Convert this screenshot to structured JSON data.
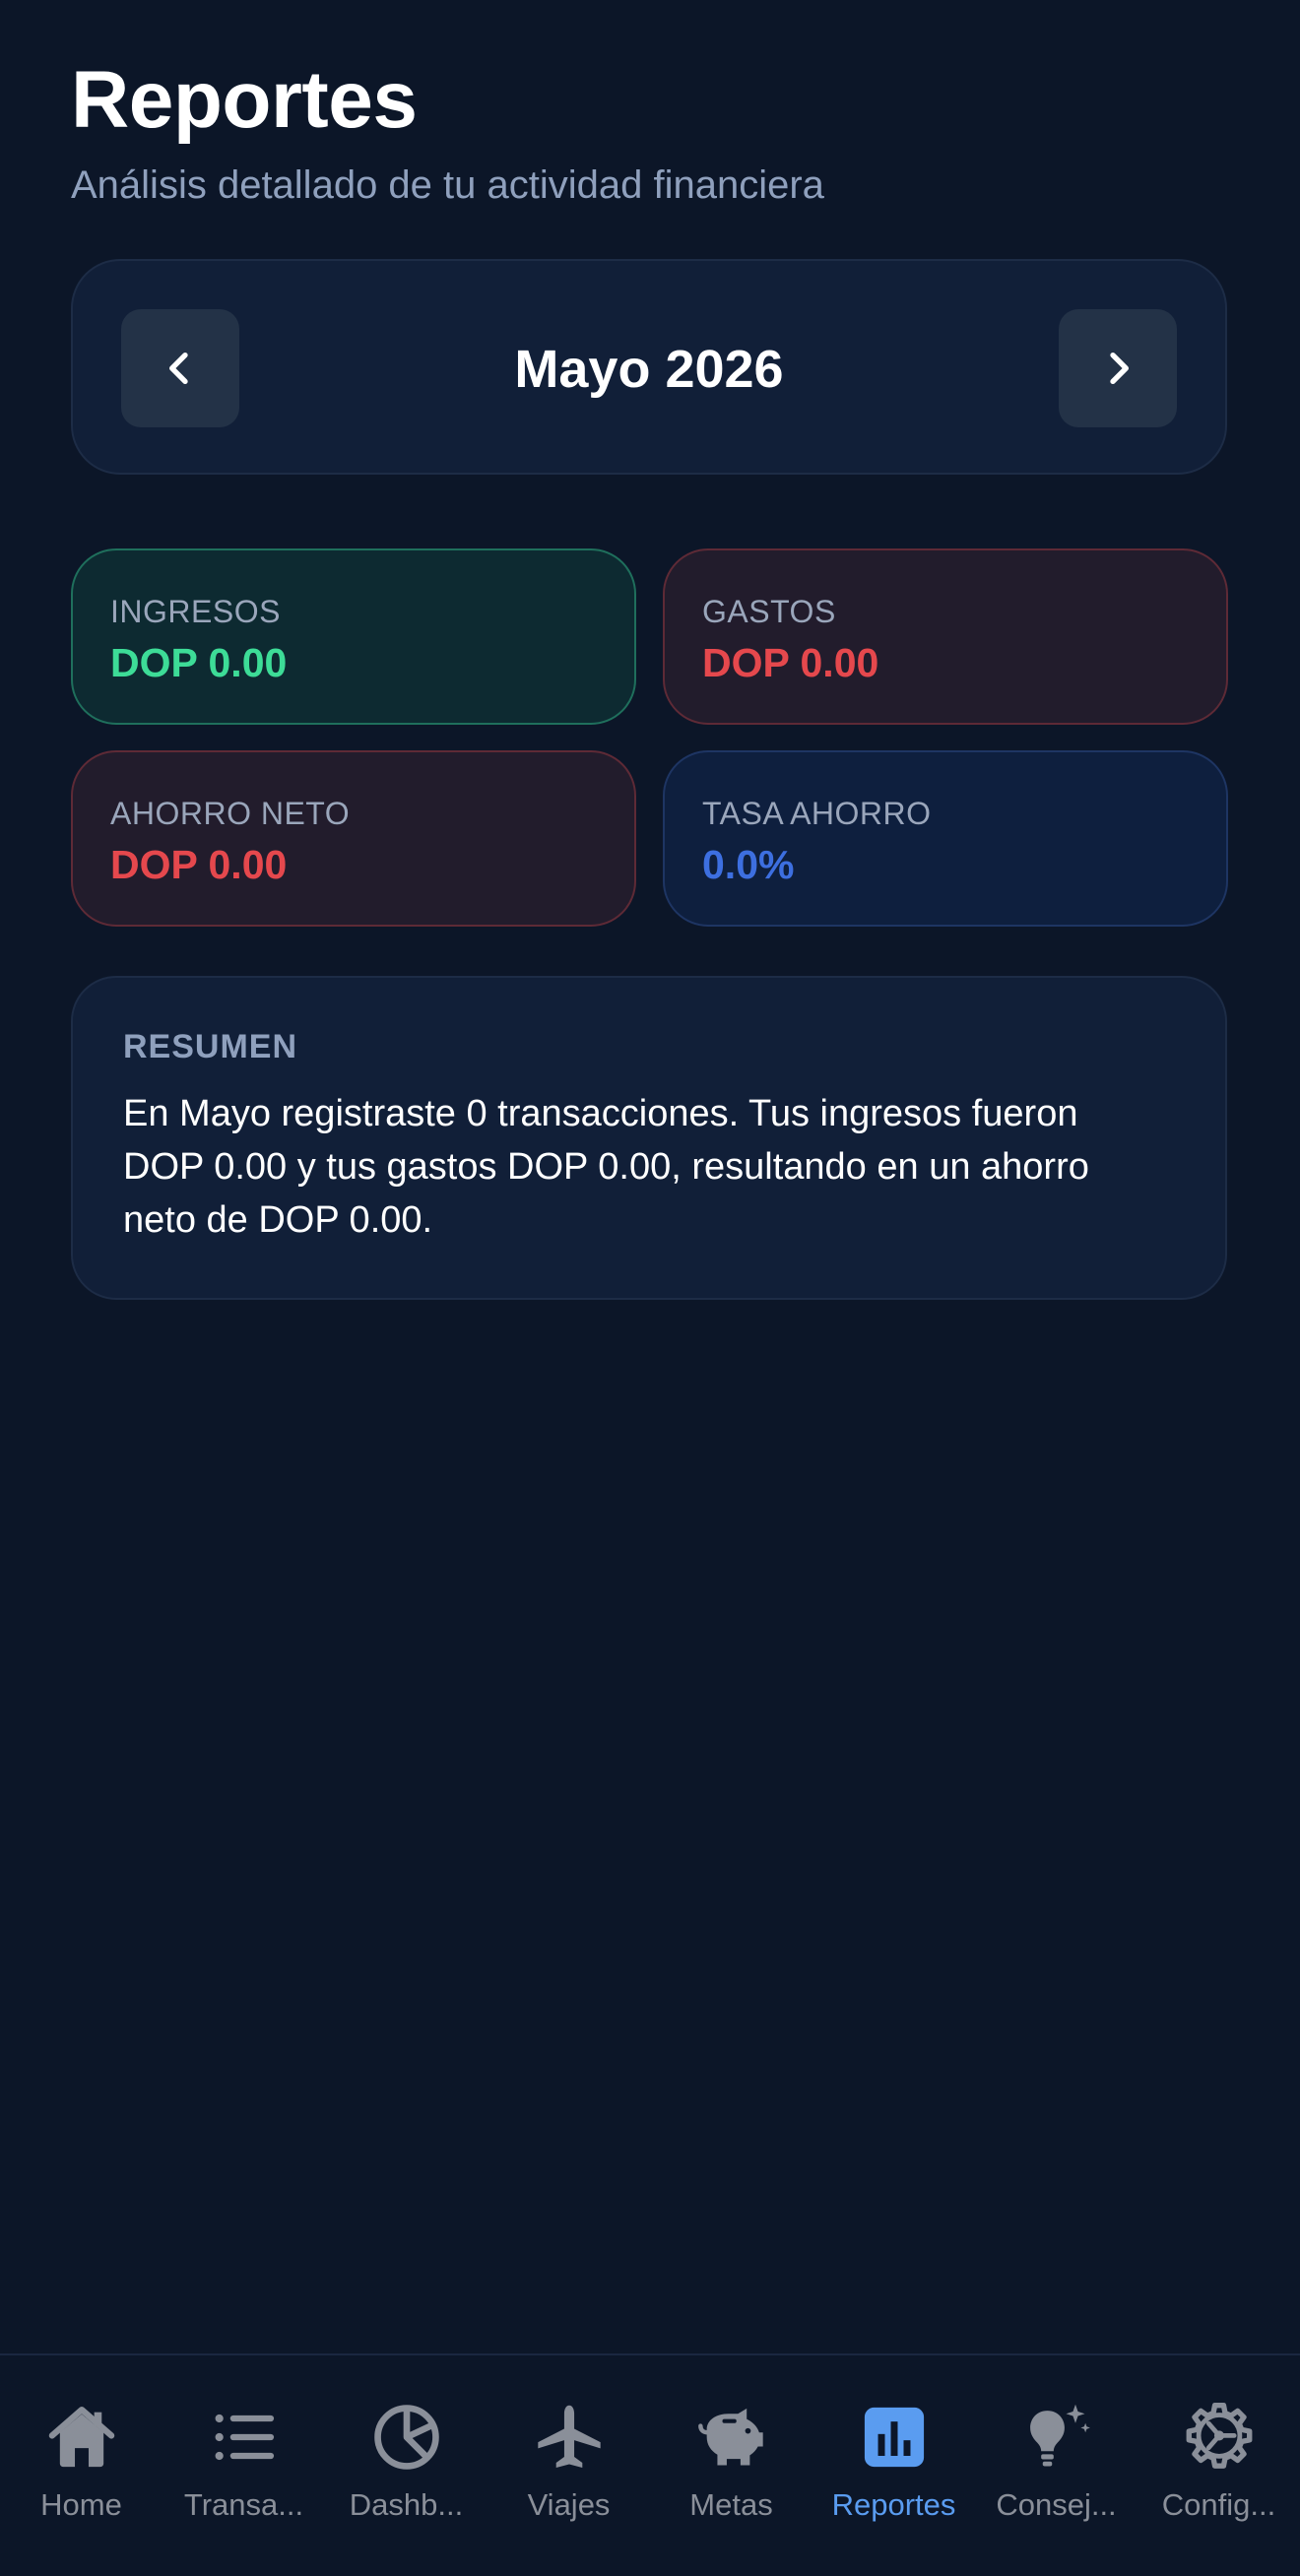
{
  "header": {
    "title": "Reportes",
    "subtitle": "Análisis detallado de tu actividad financiera"
  },
  "month_selector": {
    "label": "Mayo 2026",
    "prev_icon": "chevron-left-icon",
    "next_icon": "chevron-right-icon"
  },
  "stats": {
    "ingresos": {
      "label": "INGRESOS",
      "value": "DOP 0.00",
      "color": "#3ddc97"
    },
    "gastos": {
      "label": "GASTOS",
      "value": "DOP 0.00",
      "color": "#e5484d"
    },
    "ahorro_neto": {
      "label": "AHORRO NETO",
      "value": "DOP 0.00",
      "color": "#e5484d"
    },
    "tasa_ahorro": {
      "label": "TASA AHORRO",
      "value": "0.0%",
      "color": "#3d6fe0"
    }
  },
  "summary": {
    "title": "RESUMEN",
    "text": "En Mayo registraste 0 transacciones. Tus ingresos fueron DOP 0.00 y tus gastos DOP 0.00, resultando en un ahorro neto de DOP 0.00."
  },
  "tab_bar": {
    "active_color": "#5a9cf0",
    "inactive_color": "#8a8f99",
    "tabs": [
      {
        "label": "Home",
        "icon": "home-icon",
        "active": false
      },
      {
        "label": "Transa...",
        "icon": "list-icon",
        "active": false
      },
      {
        "label": "Dashb...",
        "icon": "pie-chart-icon",
        "active": false
      },
      {
        "label": "Viajes",
        "icon": "airplane-icon",
        "active": false
      },
      {
        "label": "Metas",
        "icon": "piggy-bank-icon",
        "active": false
      },
      {
        "label": "Reportes",
        "icon": "bar-chart-icon",
        "active": true
      },
      {
        "label": "Consej...",
        "icon": "lightbulb-icon",
        "active": false
      },
      {
        "label": "Config...",
        "icon": "gear-icon",
        "active": false
      }
    ]
  }
}
